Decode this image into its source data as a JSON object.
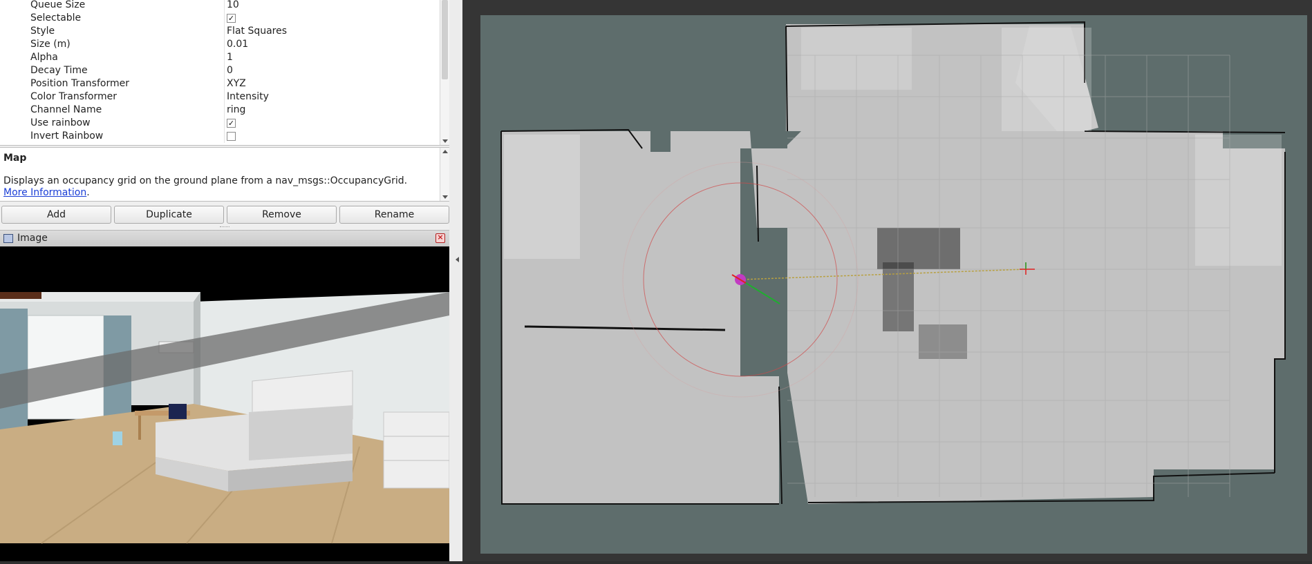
{
  "properties": [
    {
      "name": "Queue Size",
      "value": "10"
    },
    {
      "name": "Selectable",
      "checked": true
    },
    {
      "name": "Style",
      "value": "Flat Squares"
    },
    {
      "name": "Size (m)",
      "value": "0.01"
    },
    {
      "name": "Alpha",
      "value": "1"
    },
    {
      "name": "Decay Time",
      "value": "0"
    },
    {
      "name": "Position Transformer",
      "value": "XYZ"
    },
    {
      "name": "Color Transformer",
      "value": "Intensity"
    },
    {
      "name": "Channel Name",
      "value": "ring"
    },
    {
      "name": "Use rainbow",
      "checked": true
    },
    {
      "name": "Invert Rainbow",
      "checked": false
    }
  ],
  "description": {
    "title": "Map",
    "text": "Displays an occupancy grid on the ground plane from a nav_msgs::OccupancyGrid.",
    "link_text": "More Information",
    "trailing": "."
  },
  "buttons": {
    "add": "Add",
    "duplicate": "Duplicate",
    "remove": "Remove",
    "rename": "Rename"
  },
  "image_panel": {
    "title": "Image",
    "icon": "window-icon",
    "close_icon": "close-icon"
  },
  "icons": {
    "scroll_down": "chevron-down-icon",
    "collapse": "chevron-left-icon"
  },
  "colors": {
    "grid_background": "#5e6d6c",
    "free_space": "#c2c2c2",
    "occupied": "#111111",
    "view_background": "#353535",
    "link": "#1a3ed6"
  }
}
